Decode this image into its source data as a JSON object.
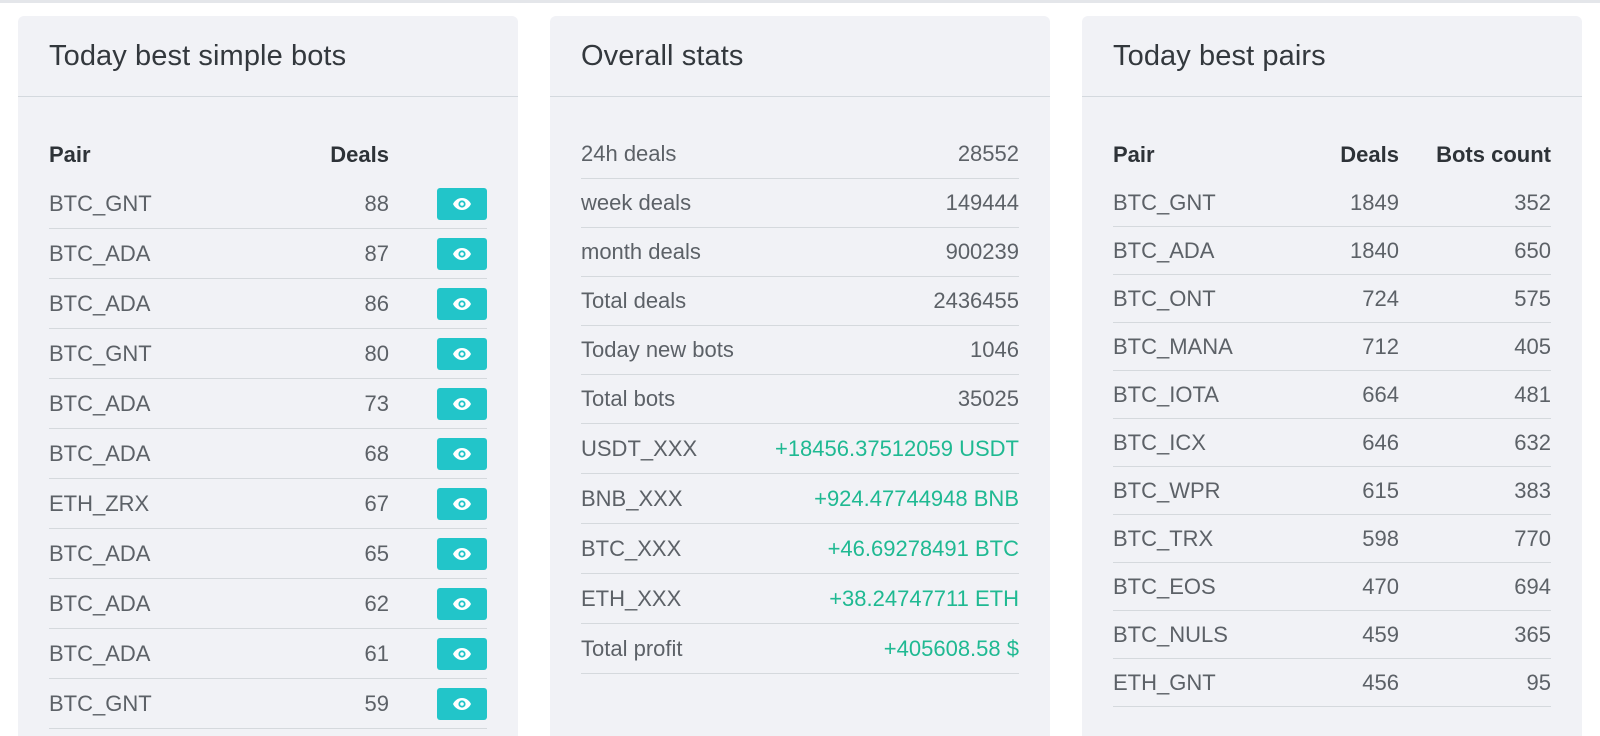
{
  "colors": {
    "accent": "#22c5c9",
    "profit_green": "#1fb992",
    "panel_bg": "#f1f2f6"
  },
  "simple_bots": {
    "title": "Today best simple bots",
    "col_pair": "Pair",
    "col_deals": "Deals",
    "action_icon": "eye-icon",
    "rows": [
      {
        "pair": "BTC_GNT",
        "deals": "88"
      },
      {
        "pair": "BTC_ADA",
        "deals": "87"
      },
      {
        "pair": "BTC_ADA",
        "deals": "86"
      },
      {
        "pair": "BTC_GNT",
        "deals": "80"
      },
      {
        "pair": "BTC_ADA",
        "deals": "73"
      },
      {
        "pair": "BTC_ADA",
        "deals": "68"
      },
      {
        "pair": "ETH_ZRX",
        "deals": "67"
      },
      {
        "pair": "BTC_ADA",
        "deals": "65"
      },
      {
        "pair": "BTC_ADA",
        "deals": "62"
      },
      {
        "pair": "BTC_ADA",
        "deals": "61"
      },
      {
        "pair": "BTC_GNT",
        "deals": "59"
      }
    ]
  },
  "overall_stats": {
    "title": "Overall stats",
    "rows": [
      {
        "label": "24h deals",
        "value": "28552"
      },
      {
        "label": "week deals",
        "value": "149444"
      },
      {
        "label": "month deals",
        "value": "900239"
      },
      {
        "label": "Total deals",
        "value": "2436455"
      },
      {
        "label": "Today new bots",
        "value": "1046"
      },
      {
        "label": "Total bots",
        "value": "35025"
      },
      {
        "label": "USDT_XXX",
        "value": "+18456.37512059 USDT"
      },
      {
        "label": "BNB_XXX",
        "value": "+924.47744948 BNB"
      },
      {
        "label": "BTC_XXX",
        "value": "+46.69278491 BTC"
      },
      {
        "label": "ETH_XXX",
        "value": "+38.24747711 ETH"
      },
      {
        "label": "Total profit",
        "value": "+405608.58 $"
      }
    ]
  },
  "best_pairs": {
    "title": "Today best pairs",
    "col_pair": "Pair",
    "col_deals": "Deals",
    "col_bots": "Bots count",
    "rows": [
      {
        "pair": "BTC_GNT",
        "deals": "1849",
        "bots": "352"
      },
      {
        "pair": "BTC_ADA",
        "deals": "1840",
        "bots": "650"
      },
      {
        "pair": "BTC_ONT",
        "deals": "724",
        "bots": "575"
      },
      {
        "pair": "BTC_MANA",
        "deals": "712",
        "bots": "405"
      },
      {
        "pair": "BTC_IOTA",
        "deals": "664",
        "bots": "481"
      },
      {
        "pair": "BTC_ICX",
        "deals": "646",
        "bots": "632"
      },
      {
        "pair": "BTC_WPR",
        "deals": "615",
        "bots": "383"
      },
      {
        "pair": "BTC_TRX",
        "deals": "598",
        "bots": "770"
      },
      {
        "pair": "BTC_EOS",
        "deals": "470",
        "bots": "694"
      },
      {
        "pair": "BTC_NULS",
        "deals": "459",
        "bots": "365"
      },
      {
        "pair": "ETH_GNT",
        "deals": "456",
        "bots": "95"
      }
    ]
  }
}
